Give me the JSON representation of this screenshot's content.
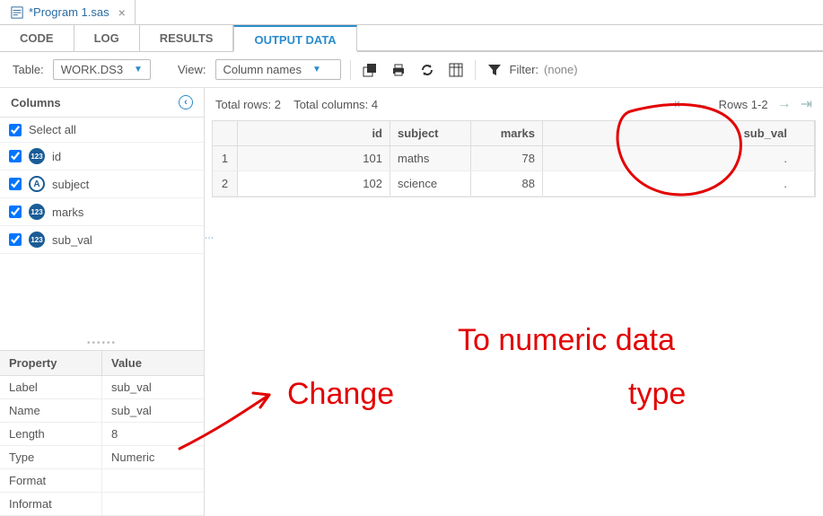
{
  "fileTab": {
    "label": "*Program 1.sas",
    "close": "×"
  },
  "mainTabs": {
    "code": "CODE",
    "log": "LOG",
    "results": "RESULTS",
    "output": "OUTPUT DATA",
    "active": "output"
  },
  "toolbar": {
    "tableLabel": "Table:",
    "tableValue": "WORK.DS3",
    "viewLabel": "View:",
    "viewValue": "Column names",
    "filterLabel": "Filter:",
    "filterValue": "(none)"
  },
  "sidebar": {
    "columnsHeader": "Columns",
    "selectAll": "Select all",
    "cols": [
      {
        "label": "id",
        "type": "num",
        "glyph": "123"
      },
      {
        "label": "subject",
        "type": "char",
        "glyph": "A"
      },
      {
        "label": "marks",
        "type": "num",
        "glyph": "123"
      },
      {
        "label": "sub_val",
        "type": "num",
        "glyph": "123"
      }
    ],
    "propHeader": {
      "k": "Property",
      "v": "Value"
    },
    "props": [
      {
        "k": "Label",
        "v": "sub_val"
      },
      {
        "k": "Name",
        "v": "sub_val"
      },
      {
        "k": "Length",
        "v": "8"
      },
      {
        "k": "Type",
        "v": "Numeric"
      },
      {
        "k": "Format",
        "v": ""
      },
      {
        "k": "Informat",
        "v": ""
      }
    ]
  },
  "dataInfo": {
    "totalRowsLabel": "Total rows: 2",
    "totalColsLabel": "Total columns: 4",
    "pagerLabel": "Rows 1-2"
  },
  "grid": {
    "headers": {
      "id": "id",
      "subject": "subject",
      "marks": "marks",
      "sub_val": "sub_val"
    },
    "rows": [
      {
        "n": "1",
        "id": "101",
        "subject": "maths",
        "marks": "78",
        "sub_val": "."
      },
      {
        "n": "2",
        "id": "102",
        "subject": "science",
        "marks": "88",
        "sub_val": "."
      }
    ]
  },
  "annotations": {
    "change": "Change",
    "to_numeric": "To numeric data",
    "type": "type"
  }
}
